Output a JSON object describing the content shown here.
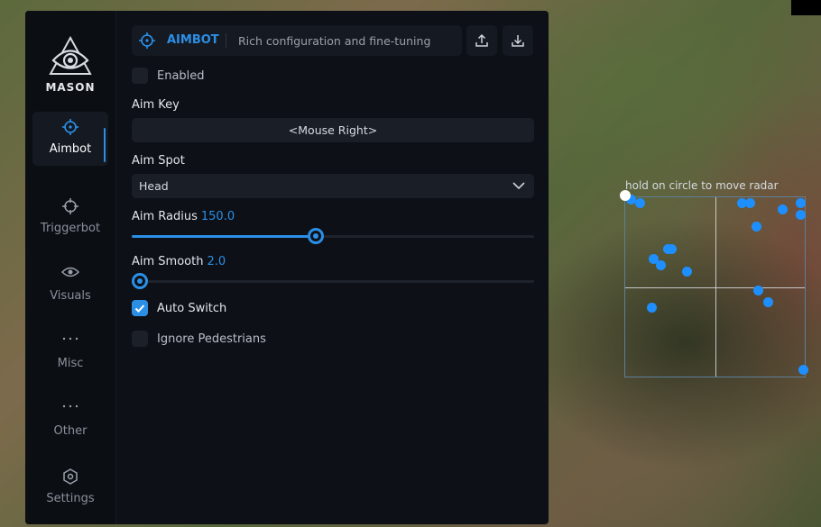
{
  "app": {
    "brand": "MASON"
  },
  "sidebar": {
    "items": [
      {
        "label": "Aimbot",
        "icon": "crosshair-icon",
        "active": true
      },
      {
        "label": "Triggerbot",
        "icon": "target-icon",
        "active": false
      },
      {
        "label": "Visuals",
        "icon": "eye-icon",
        "active": false
      },
      {
        "label": "Misc",
        "icon": "ellipsis-icon",
        "active": false
      },
      {
        "label": "Other",
        "icon": "ellipsis-icon",
        "active": false
      },
      {
        "label": "Settings",
        "icon": "gear-icon",
        "active": false
      }
    ]
  },
  "header": {
    "title": "AIMBOT",
    "subtitle": "Rich configuration and fine-tuning",
    "buttons": [
      {
        "icon": "upload-icon"
      },
      {
        "icon": "download-icon"
      }
    ]
  },
  "settings": {
    "enabled": {
      "label": "Enabled",
      "checked": false
    },
    "aim_key": {
      "label": "Aim Key",
      "value": "<Mouse Right>"
    },
    "aim_spot": {
      "label": "Aim Spot",
      "value": "Head"
    },
    "aim_radius": {
      "label": "Aim Radius",
      "value": "150.0",
      "fraction": 0.458
    },
    "aim_smooth": {
      "label": "Aim Smooth",
      "value": "2.0",
      "fraction": 0.02
    },
    "auto_switch": {
      "label": "Auto Switch",
      "checked": true
    },
    "ignore_pedestrians": {
      "label": "Ignore Pedestrians",
      "checked": false
    }
  },
  "radar": {
    "hint": "hold on circle to move radar",
    "dot_color": "#1e8fff"
  },
  "colors": {
    "accent": "#2b8fe6",
    "panel_bg": "#0d1016"
  }
}
